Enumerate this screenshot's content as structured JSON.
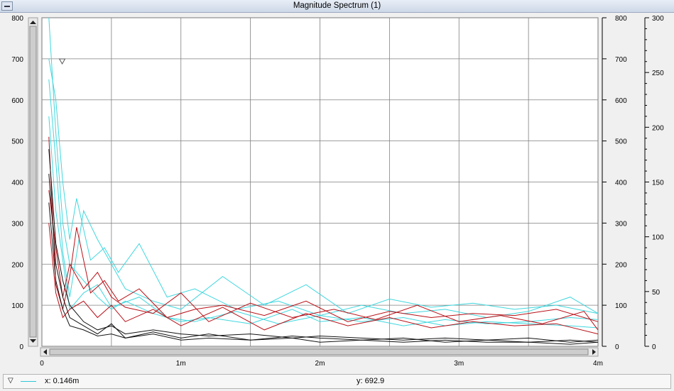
{
  "window": {
    "title": "Magnitude Spectrum (1)"
  },
  "colors": {
    "grid": "#7f7f7f",
    "plot_bg": "#ffffff",
    "cyan": "#3fd7de",
    "red": "#b80f16",
    "black": "#111111"
  },
  "status": {
    "x_readout": "x: 0.146m",
    "y_readout": "y: 692.9",
    "marker_glyph": "▽"
  },
  "chart_data": {
    "type": "line",
    "title": "Magnitude Spectrum (1)",
    "xlabel": "",
    "ylabel": "",
    "xlim": [
      0,
      4
    ],
    "ylim": [
      0,
      800
    ],
    "y2lim": [
      0,
      300
    ],
    "grid": true,
    "x_ticks": [
      0,
      1,
      2,
      3,
      4
    ],
    "x_tick_labels": [
      "0",
      "1m",
      "2m",
      "3m",
      "4m"
    ],
    "y_ticks": [
      0,
      100,
      200,
      300,
      400,
      500,
      600,
      700,
      800
    ],
    "y_tick_labels": [
      "0",
      "100",
      "200",
      "300",
      "400",
      "500",
      "600",
      "700",
      "800"
    ],
    "y2_ticks": [
      0,
      50,
      100,
      150,
      200,
      250,
      300
    ],
    "y2_tick_labels": [
      "0",
      "50",
      "100",
      "150",
      "200",
      "250",
      "300"
    ],
    "marker": {
      "x": 0.146,
      "y": 692.9
    },
    "series": [
      {
        "color": "cyan",
        "x": [
          0.05,
          0.1,
          0.15,
          0.2,
          0.3,
          0.4,
          0.5,
          0.6,
          0.8,
          1.0,
          1.2,
          1.5,
          1.8,
          2.0,
          2.3,
          2.6,
          2.9,
          3.2,
          3.5,
          3.8,
          4.0
        ],
        "y": [
          800,
          520,
          300,
          200,
          160,
          120,
          90,
          110,
          80,
          60,
          70,
          55,
          90,
          60,
          70,
          50,
          65,
          55,
          60,
          70,
          65
        ]
      },
      {
        "color": "cyan",
        "x": [
          0.05,
          0.1,
          0.15,
          0.2,
          0.25,
          0.35,
          0.45,
          0.55,
          0.7,
          0.9,
          1.1,
          1.4,
          1.7,
          2.0,
          2.3,
          2.6,
          2.9,
          3.2,
          3.5,
          3.8,
          4.0
        ],
        "y": [
          700,
          600,
          400,
          260,
          360,
          210,
          240,
          180,
          250,
          120,
          140,
          90,
          110,
          75,
          100,
          80,
          90,
          70,
          85,
          120,
          80
        ]
      },
      {
        "color": "cyan",
        "x": [
          0.05,
          0.1,
          0.15,
          0.2,
          0.3,
          0.4,
          0.5,
          0.6,
          0.8,
          1.0,
          1.3,
          1.6,
          1.9,
          2.2,
          2.5,
          2.8,
          3.1,
          3.4,
          3.7,
          4.0
        ],
        "y": [
          650,
          450,
          230,
          120,
          330,
          260,
          200,
          140,
          110,
          90,
          170,
          100,
          150,
          80,
          115,
          95,
          105,
          90,
          100,
          80
        ]
      },
      {
        "color": "cyan",
        "x": [
          0.05,
          0.1,
          0.15,
          0.2,
          0.3,
          0.4,
          0.5,
          0.7,
          0.9,
          1.1,
          1.4,
          1.7,
          2.0,
          2.3,
          2.6,
          2.9,
          3.2,
          3.5,
          3.8,
          4.0
        ],
        "y": [
          560,
          330,
          210,
          90,
          130,
          150,
          95,
          120,
          70,
          60,
          85,
          55,
          75,
          60,
          70,
          50,
          60,
          55,
          50,
          45
        ]
      },
      {
        "color": "red",
        "x": [
          0.05,
          0.1,
          0.15,
          0.2,
          0.25,
          0.35,
          0.45,
          0.55,
          0.7,
          0.9,
          1.1,
          1.3,
          1.6,
          1.9,
          2.2,
          2.5,
          2.8,
          3.1,
          3.4,
          3.7,
          4.0
        ],
        "y": [
          510,
          150,
          90,
          170,
          290,
          130,
          160,
          110,
          140,
          70,
          90,
          100,
          75,
          110,
          60,
          85,
          70,
          80,
          75,
          90,
          60
        ]
      },
      {
        "color": "red",
        "x": [
          0.05,
          0.1,
          0.15,
          0.2,
          0.3,
          0.4,
          0.5,
          0.6,
          0.8,
          1.0,
          1.2,
          1.5,
          1.8,
          2.1,
          2.4,
          2.7,
          3.0,
          3.3,
          3.6,
          3.9,
          4.0
        ],
        "y": [
          380,
          240,
          120,
          200,
          140,
          180,
          120,
          95,
          80,
          130,
          60,
          105,
          70,
          90,
          65,
          100,
          60,
          75,
          55,
          85,
          40
        ]
      },
      {
        "color": "red",
        "x": [
          0.05,
          0.1,
          0.15,
          0.2,
          0.3,
          0.4,
          0.5,
          0.6,
          0.8,
          1.0,
          1.3,
          1.6,
          1.9,
          2.2,
          2.5,
          2.8,
          3.1,
          3.4,
          3.7,
          4.0
        ],
        "y": [
          300,
          130,
          70,
          90,
          110,
          70,
          100,
          60,
          90,
          50,
          95,
          40,
          80,
          50,
          70,
          45,
          60,
          50,
          55,
          30
        ]
      },
      {
        "color": "black",
        "x": [
          0.05,
          0.1,
          0.15,
          0.2,
          0.3,
          0.4,
          0.5,
          0.6,
          0.8,
          1.0,
          1.2,
          1.5,
          1.8,
          2.0,
          2.3,
          2.6,
          2.9,
          3.2,
          3.5,
          3.8,
          4.0
        ],
        "y": [
          480,
          250,
          160,
          100,
          60,
          40,
          50,
          30,
          40,
          30,
          25,
          30,
          20,
          25,
          20,
          15,
          20,
          15,
          20,
          10,
          15
        ]
      },
      {
        "color": "black",
        "x": [
          0.05,
          0.1,
          0.15,
          0.2,
          0.3,
          0.4,
          0.5,
          0.6,
          0.8,
          1.0,
          1.2,
          1.5,
          1.8,
          2.0,
          2.3,
          2.6,
          2.9,
          3.2,
          3.5,
          3.8,
          4.0
        ],
        "y": [
          420,
          200,
          120,
          70,
          50,
          30,
          55,
          20,
          35,
          20,
          30,
          15,
          25,
          20,
          15,
          20,
          10,
          15,
          10,
          15,
          10
        ]
      },
      {
        "color": "black",
        "x": [
          0.05,
          0.1,
          0.15,
          0.2,
          0.3,
          0.4,
          0.5,
          0.6,
          0.8,
          1.0,
          1.2,
          1.5,
          1.8,
          2.0,
          2.3,
          2.6,
          2.9,
          3.2,
          3.5,
          3.8,
          4.0
        ],
        "y": [
          350,
          160,
          90,
          50,
          40,
          25,
          30,
          20,
          30,
          15,
          20,
          15,
          20,
          10,
          15,
          10,
          15,
          10,
          10,
          5,
          10
        ]
      }
    ]
  }
}
